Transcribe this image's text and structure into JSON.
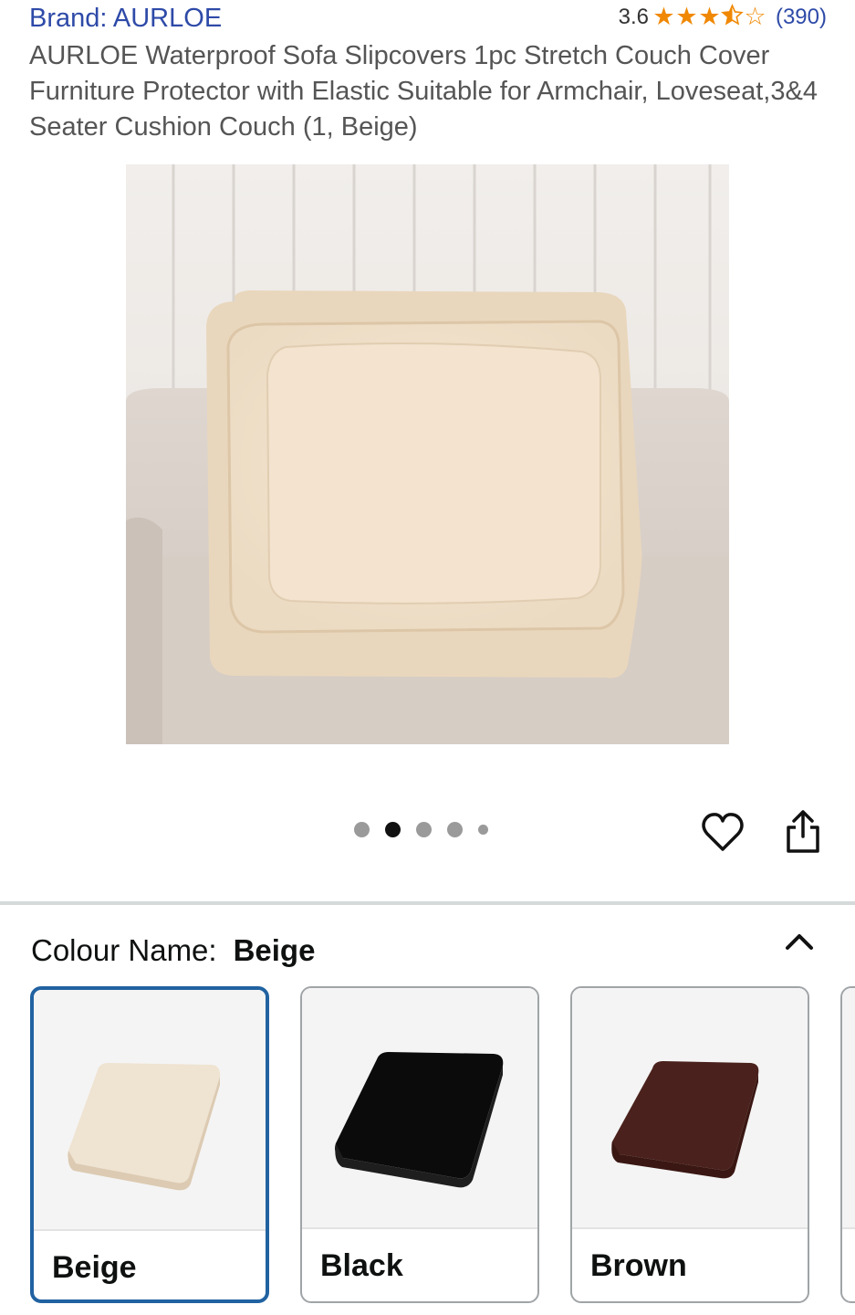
{
  "header": {
    "brand": "Brand: AURLOE",
    "rating_value": "3.6",
    "rating_count": "(390)",
    "star_color": "#f08804",
    "stars": 3.5
  },
  "product": {
    "title": "AURLOE Waterproof Sofa Slipcovers 1pc Stretch Couch Cover Furniture Protector with Elastic Suitable for Armchair, Loveseat,3&4 Seater Cushion Couch (1, Beige)"
  },
  "carousel": {
    "total_dots": 5,
    "active_index": 1
  },
  "actions": {
    "wishlist_icon": "heart-outline-icon",
    "share_icon": "share-icon"
  },
  "variation": {
    "label": "Colour Name:",
    "selected_value": "Beige",
    "collapse_icon": "chevron-up-icon",
    "options": [
      {
        "label": "Beige",
        "color": "#efe3d1",
        "selected": true
      },
      {
        "label": "Black",
        "color": "#0b0b0b",
        "selected": false
      },
      {
        "label": "Brown",
        "color": "#4a211c",
        "selected": false
      }
    ]
  },
  "colors": {
    "link": "#2e4aa8",
    "selected_border": "#2162a1"
  }
}
